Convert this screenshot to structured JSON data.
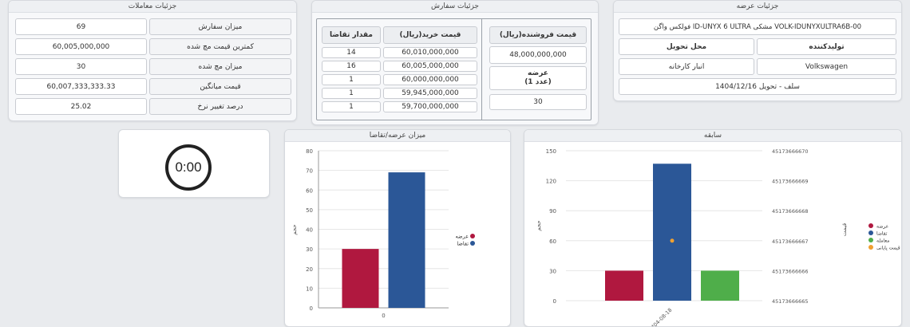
{
  "trades": {
    "title": "جزئیات معاملات",
    "rows": [
      {
        "label": "میزان سفارش",
        "value": "69"
      },
      {
        "label": "کمترین قیمت مچ شده",
        "value": "60,005,000,000"
      },
      {
        "label": "میزان مچ شده",
        "value": "30"
      },
      {
        "label": "قیمت میانگین",
        "value": "60,007,333,333.33"
      },
      {
        "label": "درصد تغییر نرخ",
        "value": "25.02"
      }
    ]
  },
  "order": {
    "title": "جزئیات سفارش",
    "buy_price_header": "قیمت خرید(ریال)",
    "demand_qty_header": "مقدار تقاضا",
    "rows": [
      {
        "price": "60,010,000,000",
        "qty": "14"
      },
      {
        "price": "60,005,000,000",
        "qty": "16"
      },
      {
        "price": "60,000,000,000",
        "qty": "1"
      },
      {
        "price": "59,945,000,000",
        "qty": "1"
      },
      {
        "price": "59,700,000,000",
        "qty": "1"
      }
    ],
    "sell_price_header": "قیمت فروشنده(ریال)",
    "sell_price": "48,000,000,000",
    "supply_label": "عرضه",
    "supply_count": "(1 عدد)",
    "supply_qty": "30"
  },
  "offer": {
    "title": "جزئیات عرضه",
    "product": "فولکس واگن ID-UNYX 6 ULTRA مشکی VOLK-IDUNYXULTRA6B-00",
    "producer_label": "تولیدکننده",
    "delivery_label": "محل تحویل",
    "producer": "Volkswagen",
    "delivery": "انبار کارخانه",
    "settlement": "سلف - تحویل 1404/12/16"
  },
  "timer": {
    "value": "0:00"
  },
  "supply_demand_chart": {
    "title": "میزان عرضه/تقاضا",
    "chart_data": {
      "type": "bar",
      "categories": [
        "0"
      ],
      "series": [
        {
          "name": "عرضه",
          "values": [
            30
          ],
          "color": "#b0183f"
        },
        {
          "name": "تقاضا",
          "values": [
            69
          ],
          "color": "#2b5797"
        }
      ],
      "ylabel": "حجم",
      "ylim": [
        0,
        80
      ],
      "yticks": [
        "0",
        "10",
        "20",
        "30",
        "40",
        "50",
        "60",
        "70",
        "80"
      ],
      "legend": "right"
    }
  },
  "history_chart": {
    "title": "سابقه",
    "chart_data": {
      "type": "bar",
      "categories": [
        "1404-08-18"
      ],
      "series": [
        {
          "name": "عرضه",
          "values": [
            30
          ],
          "color": "#b0183f"
        },
        {
          "name": "تقاضا",
          "values": [
            137
          ],
          "color": "#2b5797"
        },
        {
          "name": "معامله",
          "values": [
            30
          ],
          "color": "#4fae4a"
        },
        {
          "name": "قیمت پایانی",
          "values": [
            45173666667
          ],
          "color": "#f0a030",
          "axis": "right"
        }
      ],
      "ylabel": "حجم",
      "ylim": [
        0,
        150
      ],
      "yticks": [
        "0",
        "30",
        "60",
        "90",
        "120",
        "150"
      ],
      "y2label": "قیمت",
      "y2ticks": [
        "45173666665",
        "45173666666",
        "45173666667",
        "45173666668",
        "45173666669",
        "45173666670"
      ],
      "legend": "right"
    }
  }
}
